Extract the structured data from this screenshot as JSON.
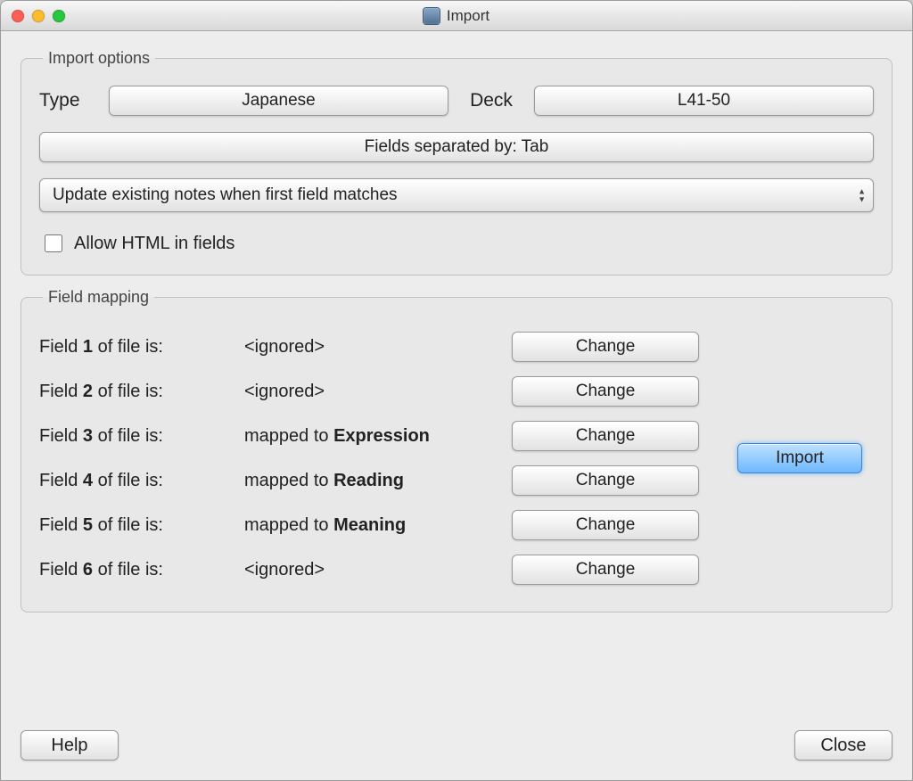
{
  "window": {
    "title": "Import"
  },
  "import_options": {
    "legend": "Import options",
    "type_label": "Type",
    "deck_label": "Deck",
    "type_value": "Japanese",
    "deck_value": "L41-50",
    "separator_button": "Fields separated by: Tab",
    "update_mode": "Update existing notes when first field matches",
    "allow_html_label": "Allow HTML in fields",
    "allow_html_checked": false
  },
  "field_mapping": {
    "legend": "Field mapping",
    "field_word": "Field",
    "of_file_is": "of file is:",
    "mapped_to": "mapped to",
    "ignored": "<ignored>",
    "change_label": "Change",
    "rows": [
      {
        "n": "1",
        "target": null
      },
      {
        "n": "2",
        "target": null
      },
      {
        "n": "3",
        "target": "Expression"
      },
      {
        "n": "4",
        "target": "Reading"
      },
      {
        "n": "5",
        "target": "Meaning"
      },
      {
        "n": "6",
        "target": null
      }
    ],
    "import_label": "Import"
  },
  "footer": {
    "help": "Help",
    "close": "Close"
  }
}
